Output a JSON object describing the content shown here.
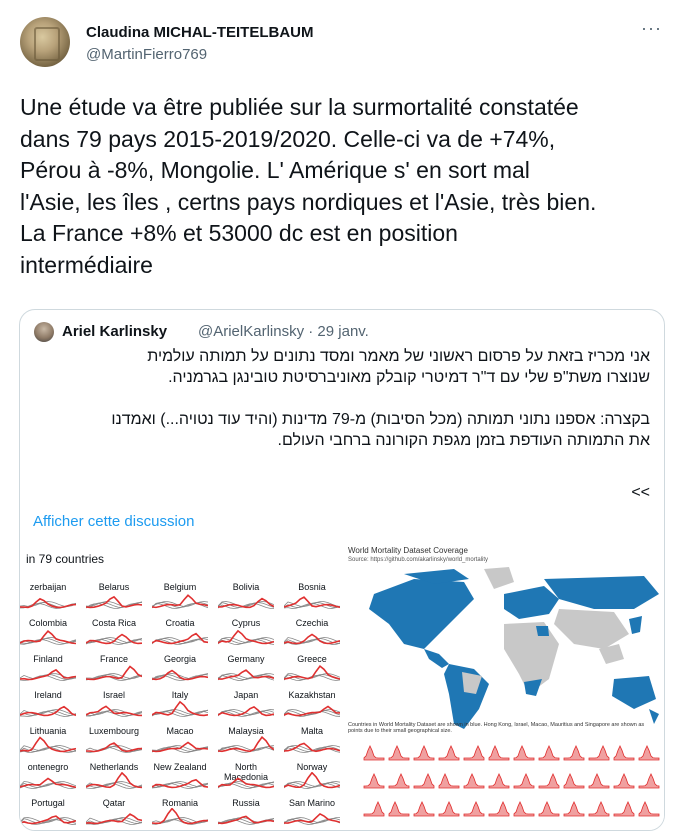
{
  "author": {
    "name": "Claudina MICHAL-TEITELBAUM",
    "handle": "@MartinFierro769"
  },
  "more_icon": "more-horizontal-icon",
  "tweet_text": "Une étude va être publiée sur la surmortalité constatée\ndans 79 pays 2015-2019/2020. Celle-ci va de +74%,\nPérou à -8%, Mongolie. L' Amérique s' en sort mal\nl'Asie, les îles , certns pays nordiques et l'Asie, très bien.\nLa France +8% et 53000 dc est en position\nintermédiaire",
  "quote": {
    "name": "Ariel Karlinsky",
    "handle": "@ArielKarlinsky · 29 janv.",
    "text": "אני מכריז בזאת על פרסום ראשוני של מאמר ומסד נתונים על תמותה עולמית\nשנוצרו משת\"פ שלי עם ד\"ר דמיטרי קובלק מאוניברסיטת טובינגן בגרמניה.\n\nבקצרה: אספנו נתוני תמותה (מכל הסיבות) מ-79 מדינות (והיד עוד נטויה...) ואמדנו\nאת התמותה העודפת בזמן מגפת הקורונה ברחבי העולם.",
    "arrows": "<<",
    "link": "Afficher cette discussion"
  },
  "media": {
    "left_title": "in 79 countries",
    "countries": [
      "zerbaijan",
      "Belarus",
      "Belgium",
      "Bolivia",
      "Bosnia",
      "Colombia",
      "Costa Rica",
      "Croatia",
      "Cyprus",
      "Czechia",
      "Finland",
      "France",
      "Georgia",
      "Germany",
      "Greece",
      "Ireland",
      "Israel",
      "Italy",
      "Japan",
      "Kazakhstan",
      "Lithuania",
      "Luxembourg",
      "Macao",
      "Malaysia",
      "Malta",
      "ontenegro",
      "Netherlands",
      "New Zealand",
      "North Macedonia",
      "Norway",
      "Portugal",
      "Qatar",
      "Romania",
      "Russia",
      "San Marino"
    ],
    "map_title": "World Mortality Dataset Coverage",
    "map_source": "Source: https://github.com/akarlinsky/world_mortality",
    "map_legend": "Countries in World Mortality Dataset are shown in blue. Hong Kong, Israel, Macao, Mauritius and Singapore are shown as points due to their small geographical size.",
    "colors": {
      "covered": "#1f77b4",
      "not_covered": "#c8c8c8",
      "excess": "#e03030"
    }
  }
}
